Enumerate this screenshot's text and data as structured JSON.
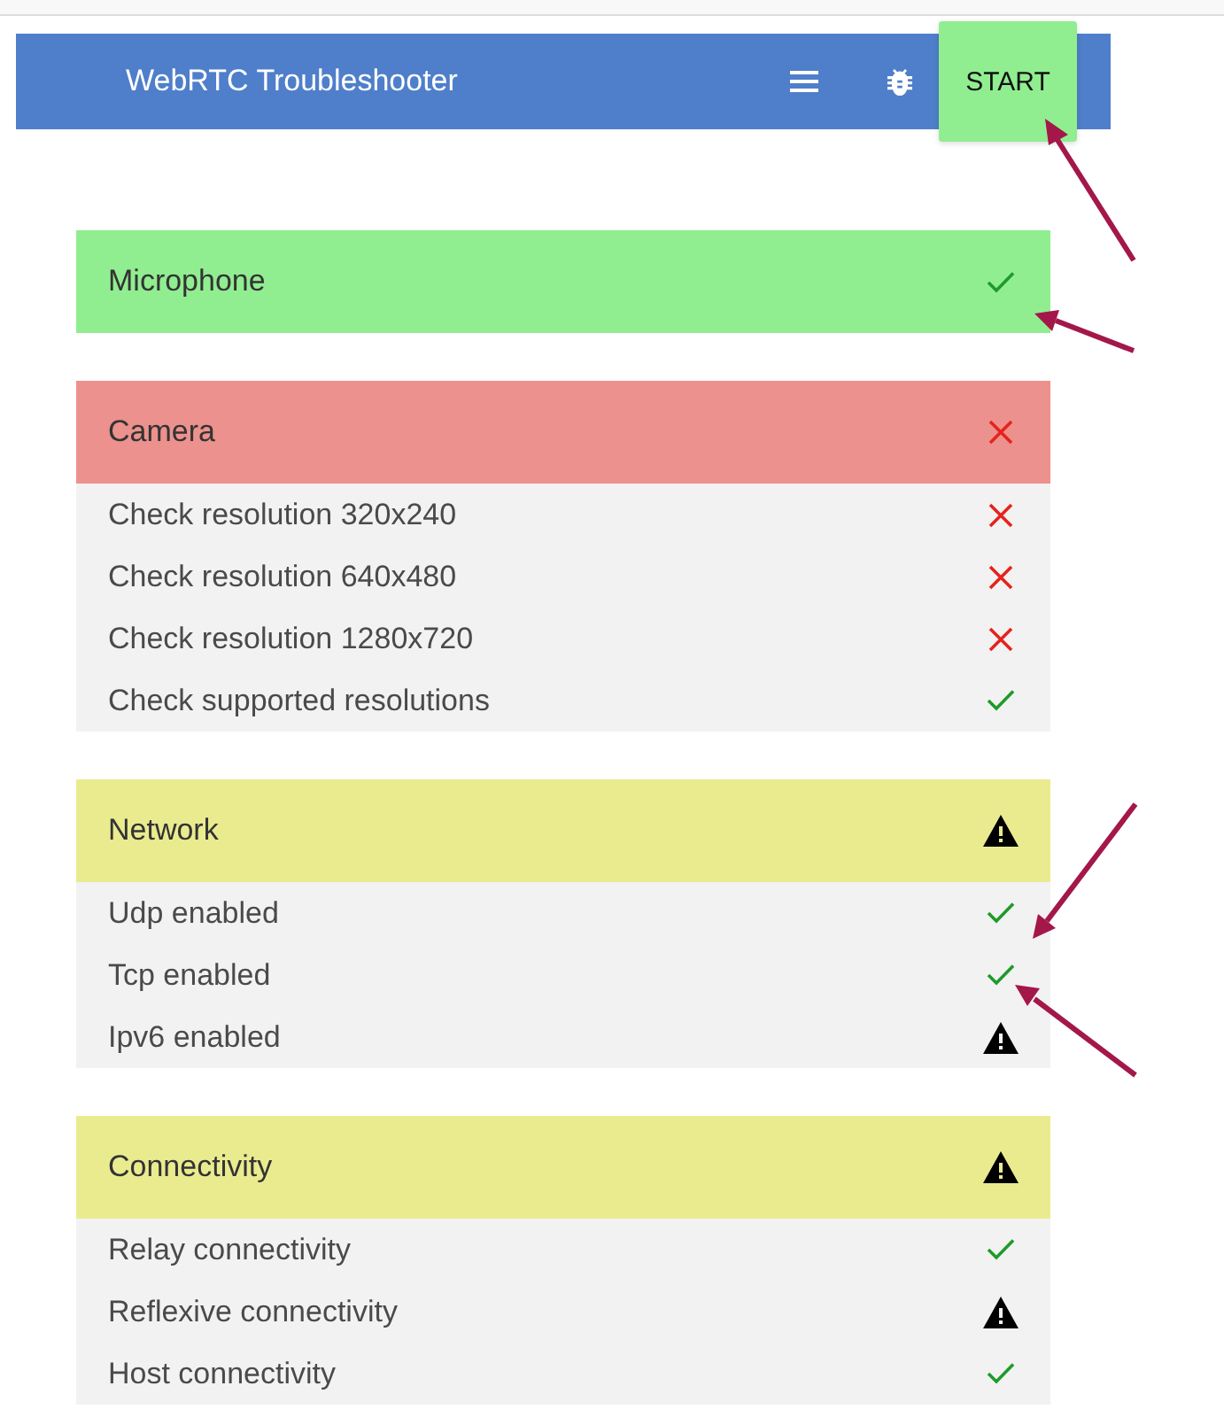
{
  "header": {
    "title": "WebRTC Troubleshooter",
    "start_button": "START"
  },
  "sections": [
    {
      "name": "Microphone",
      "kind": "pass"
    },
    {
      "name": "Camera",
      "kind": "fail",
      "tests": [
        {
          "name": "Check resolution 320x240",
          "kind": "fail"
        },
        {
          "name": "Check resolution 640x480",
          "kind": "fail"
        },
        {
          "name": "Check resolution 1280x720",
          "kind": "fail"
        },
        {
          "name": "Check supported resolutions",
          "kind": "pass"
        }
      ]
    },
    {
      "name": "Network",
      "kind": "warn",
      "tests": [
        {
          "name": "Udp enabled",
          "kind": "pass"
        },
        {
          "name": "Tcp enabled",
          "kind": "pass"
        },
        {
          "name": "Ipv6 enabled",
          "kind": "warn"
        }
      ]
    },
    {
      "name": "Connectivity",
      "kind": "warn",
      "tests": [
        {
          "name": "Relay connectivity",
          "kind": "pass"
        },
        {
          "name": "Reflexive connectivity",
          "kind": "warn"
        },
        {
          "name": "Host connectivity",
          "kind": "pass"
        }
      ]
    }
  ]
}
